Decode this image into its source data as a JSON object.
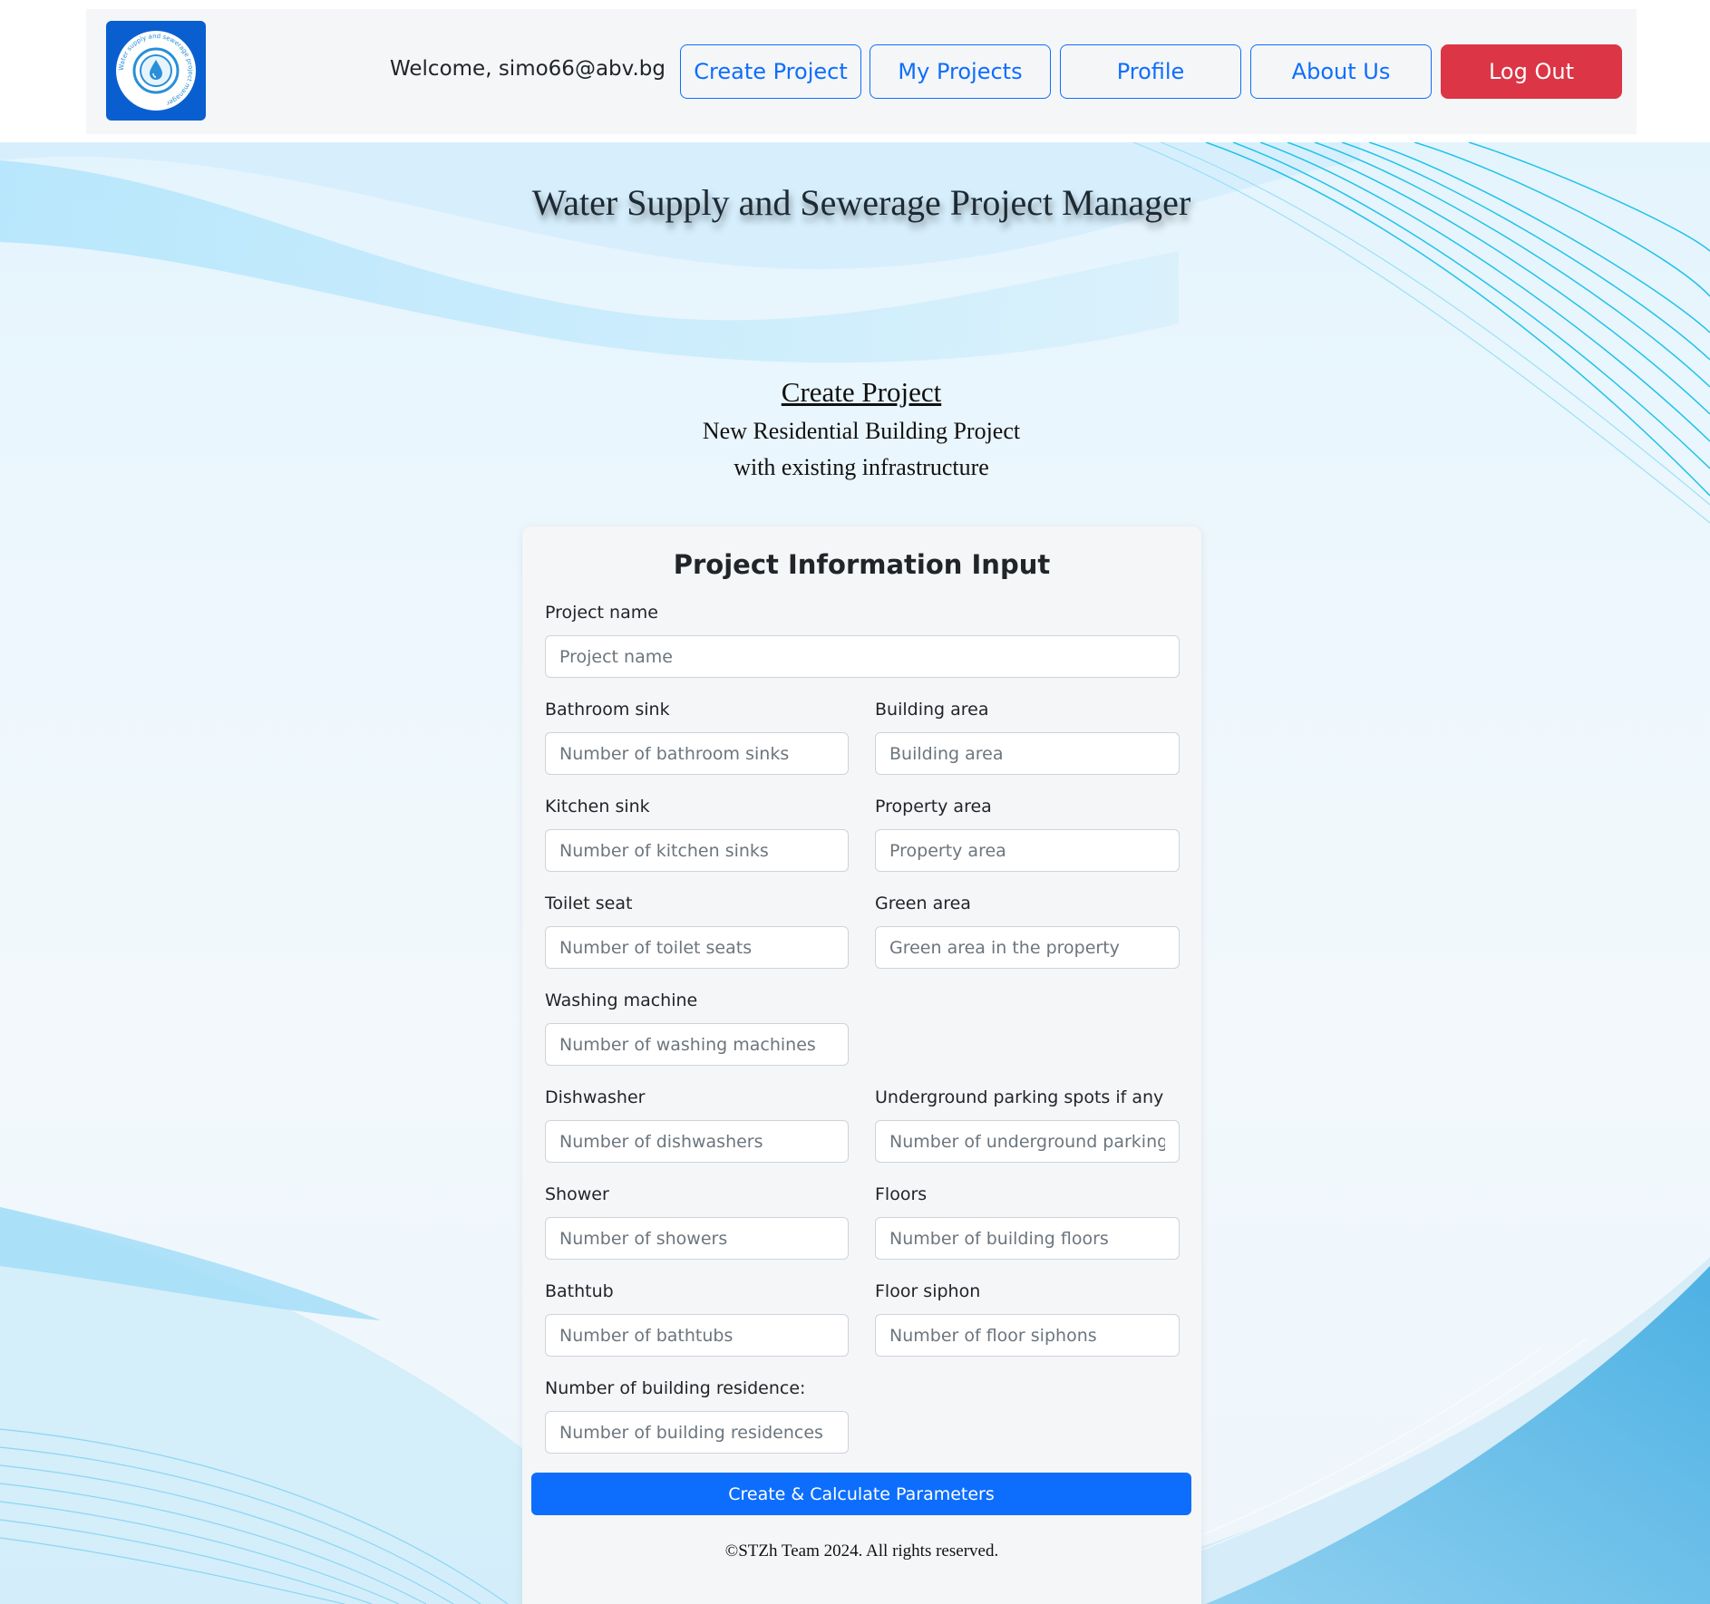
{
  "colors": {
    "primary": "#0d6efd",
    "danger": "#dc3545",
    "logo_bg": "#0a5fd0",
    "navbar_bg": "#f5f6f8"
  },
  "navbar": {
    "logo_icon": "water-drop-logo-icon",
    "logo_ring_text": "Water supply and sewerage project manager",
    "welcome": "Welcome, simo66@abv.bg",
    "buttons": {
      "create_project": "Create Project",
      "my_projects": "My Projects",
      "profile": "Profile",
      "about_us": "About Us",
      "log_out": "Log Out"
    }
  },
  "header": {
    "app_title": "Water Supply and Sewerage Project Manager",
    "section_title": "Create Project",
    "subtitle_line1": "New Residential Building Project",
    "subtitle_line2": "with existing infrastructure"
  },
  "form": {
    "title": "Project Information Input",
    "project_name": {
      "label": "Project name",
      "placeholder": "Project name",
      "value": ""
    },
    "bathroom_sink": {
      "label": "Bathroom sink",
      "placeholder": "Number of bathroom sinks",
      "value": ""
    },
    "building_area": {
      "label": "Building area",
      "placeholder": "Building area",
      "value": ""
    },
    "kitchen_sink": {
      "label": "Kitchen sink",
      "placeholder": "Number of kitchen sinks",
      "value": ""
    },
    "property_area": {
      "label": "Property area",
      "placeholder": "Property area",
      "value": ""
    },
    "toilet_seat": {
      "label": "Toilet seat",
      "placeholder": "Number of toilet seats",
      "value": ""
    },
    "green_area": {
      "label": "Green area",
      "placeholder": "Green area in the property",
      "value": ""
    },
    "washing_machine": {
      "label": "Washing machine",
      "placeholder": "Number of washing machines",
      "value": ""
    },
    "dishwasher": {
      "label": "Dishwasher",
      "placeholder": "Number of dishwashers",
      "value": ""
    },
    "underground_parking": {
      "label": "Underground parking spots if any",
      "placeholder": "Number of underground parking spots",
      "value": ""
    },
    "shower": {
      "label": "Shower",
      "placeholder": "Number of showers",
      "value": ""
    },
    "floors": {
      "label": "Floors",
      "placeholder": "Number of building floors",
      "value": ""
    },
    "bathtub": {
      "label": "Bathtub",
      "placeholder": "Number of bathtubs",
      "value": ""
    },
    "floor_siphon": {
      "label": "Floor siphon",
      "placeholder": "Number of floor siphons",
      "value": ""
    },
    "residences": {
      "label": "Number of building residence:",
      "placeholder": "Number of building residences",
      "value": ""
    },
    "submit_label": "Create & Calculate Parameters"
  },
  "footer": {
    "copyright": "©STZh Team 2024. All rights reserved."
  }
}
